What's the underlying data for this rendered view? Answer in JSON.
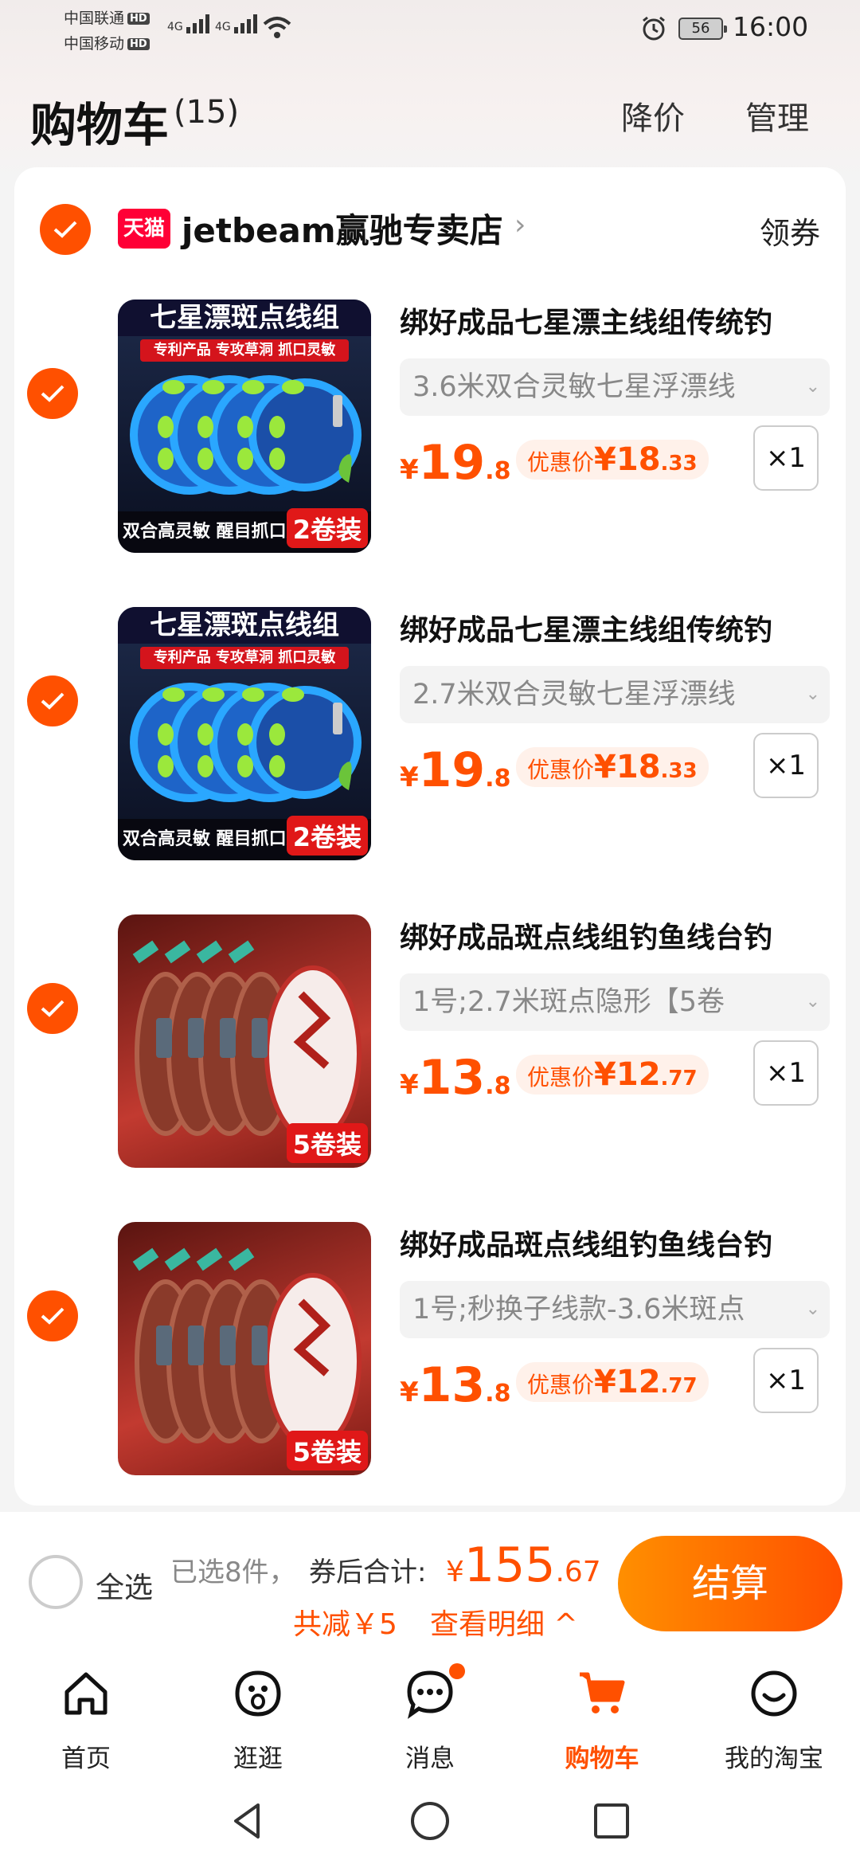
{
  "status": {
    "carrier1": "中国联通",
    "carrier2": "中国移动",
    "hd": "HD",
    "net1": "4G",
    "net2": "4G",
    "battery": "56",
    "time": "16:00"
  },
  "header": {
    "title": "购物车",
    "count": "(15)",
    "price_drop": "降价",
    "manage": "管理"
  },
  "shop": {
    "badge": "天猫",
    "name": "jetbeam赢驰专卖店",
    "coupon": "领券"
  },
  "items": [
    {
      "name": "绑好成品七星漂主线组传统钓",
      "sku": "3.6米双合灵敏七星浮漂线",
      "price_yen": "¥",
      "price_int": "19",
      "price_dec": ".8",
      "promo_label": "优惠价",
      "promo_yen": "¥",
      "promo_int": "18",
      "promo_dec": ".33",
      "qty": "×1",
      "img_title": "七星漂斑点线组",
      "img_sub": "专利产品 专攻草洞 抓口灵敏",
      "img_foot": "双合高灵敏 醒目抓口灵",
      "img_pack": "2卷装"
    },
    {
      "name": "绑好成品七星漂主线组传统钓",
      "sku": "2.7米双合灵敏七星浮漂线",
      "price_yen": "¥",
      "price_int": "19",
      "price_dec": ".8",
      "promo_label": "优惠价",
      "promo_yen": "¥",
      "promo_int": "18",
      "promo_dec": ".33",
      "qty": "×1",
      "img_title": "七星漂斑点线组",
      "img_sub": "专利产品 专攻草洞 抓口灵敏",
      "img_foot": "双合高灵敏 醒目抓口灵",
      "img_pack": "2卷装"
    },
    {
      "name": "绑好成品斑点线组钓鱼线台钓",
      "sku": "1号;2.7米斑点隐形【5卷",
      "price_yen": "¥",
      "price_int": "13",
      "price_dec": ".8",
      "promo_label": "优惠价",
      "promo_yen": "¥",
      "promo_int": "12",
      "promo_dec": ".77",
      "qty": "×1",
      "img_pack": "5卷装"
    },
    {
      "name": "绑好成品斑点线组钓鱼线台钓",
      "sku": "1号;秒换子线款-3.6米斑点",
      "price_yen": "¥",
      "price_int": "13",
      "price_dec": ".8",
      "promo_label": "优惠价",
      "promo_yen": "¥",
      "promo_int": "12",
      "promo_dec": ".77",
      "qty": "×1",
      "img_pack": "5卷装"
    }
  ],
  "summary": {
    "select_all": "全选",
    "selected": "已选8件，",
    "total_label": "券后合计:",
    "total_yen": "¥",
    "total_int": "155",
    "total_dec": ".67",
    "discount": "共减￥5",
    "details": "查看明细 ^",
    "checkout": "结算"
  },
  "tabs": [
    {
      "label": "首页",
      "icon": "home-icon"
    },
    {
      "label": "逛逛",
      "icon": "browse-icon"
    },
    {
      "label": "消息",
      "icon": "message-icon"
    },
    {
      "label": "购物车",
      "icon": "cart-icon"
    },
    {
      "label": "我的淘宝",
      "icon": "profile-icon"
    }
  ],
  "colors": {
    "accent": "#ff5000",
    "tmall": "#ff0036"
  }
}
